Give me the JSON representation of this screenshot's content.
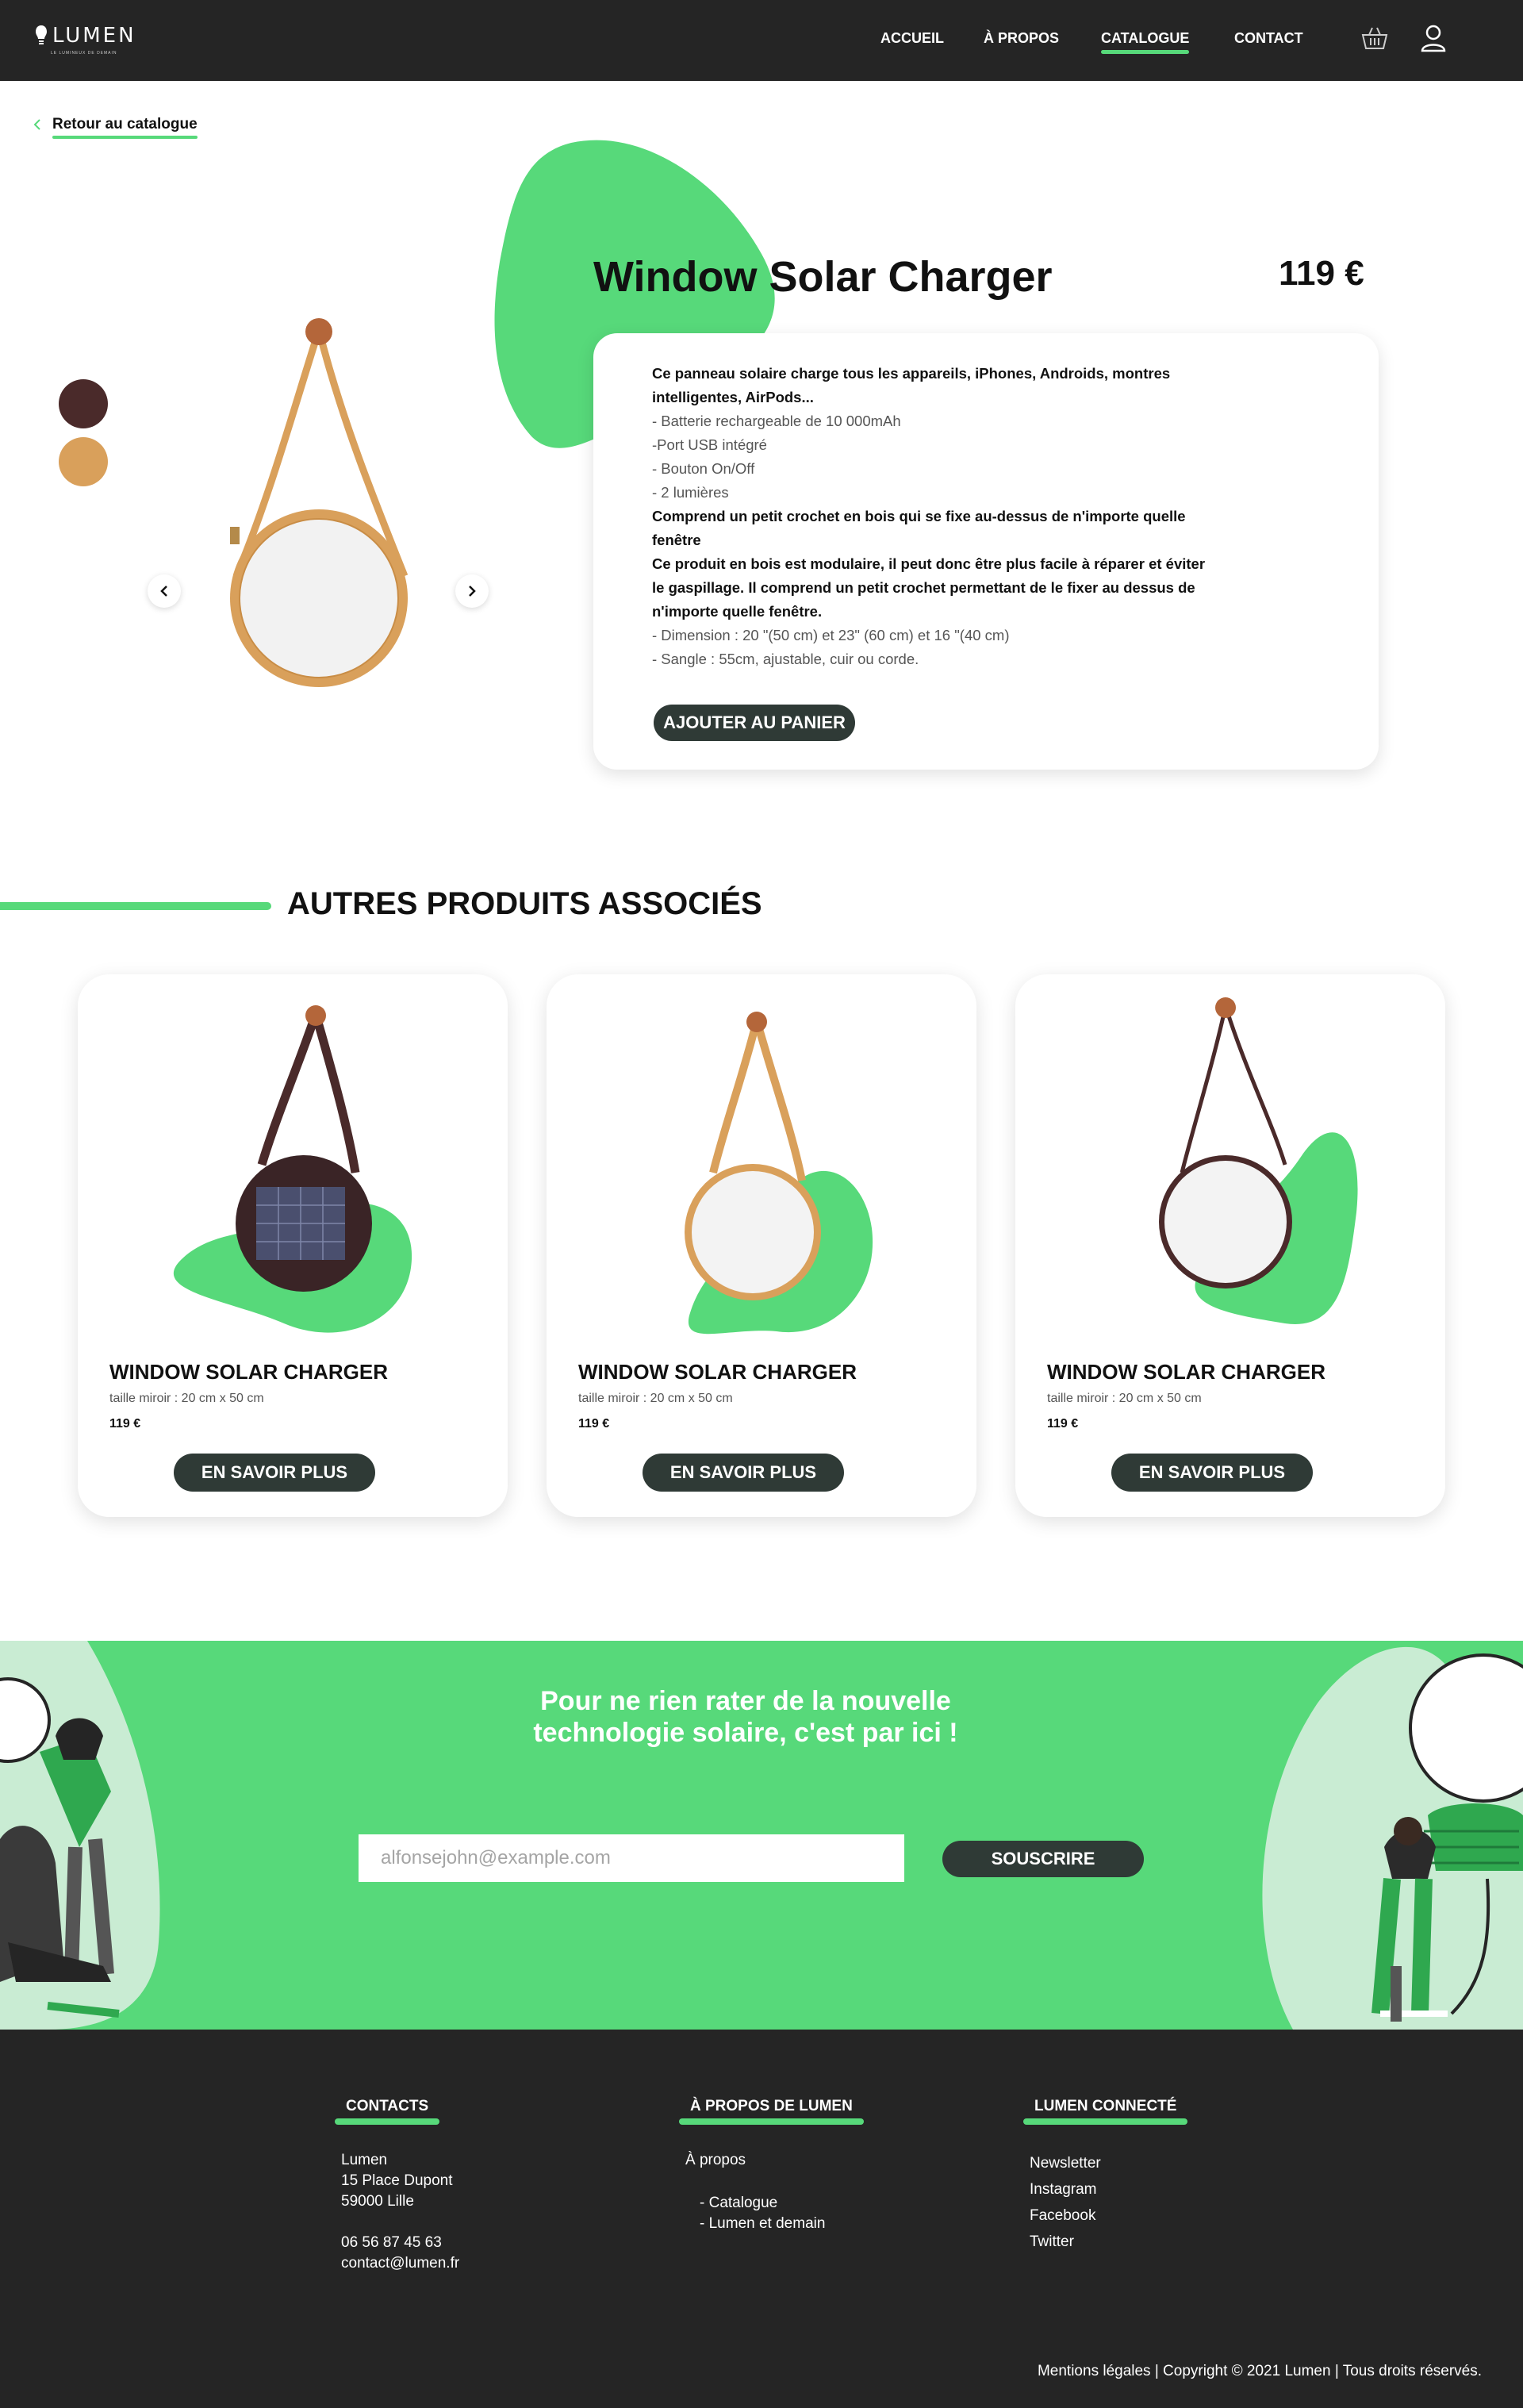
{
  "header": {
    "logo_text": "LUMEN",
    "logo_tagline": "LE LUMINEUX DE DEMAIN",
    "nav": [
      {
        "label": "ACCUEIL",
        "active": false
      },
      {
        "label": "À PROPOS",
        "active": false
      },
      {
        "label": "CATALOGUE",
        "active": true
      },
      {
        "label": "CONTACT",
        "active": false
      }
    ],
    "icons": [
      "basket-icon",
      "user-icon"
    ]
  },
  "back_link": {
    "label": "Retour au catalogue"
  },
  "product": {
    "title": "Window Solar Charger",
    "price": "119 €",
    "swatches": [
      "#4a2a2a",
      "#d9a05b"
    ],
    "description": [
      {
        "text": "Ce panneau solaire charge tous les appareils, iPhones, Androids, montres",
        "style": "b"
      },
      {
        "text": "intelligentes, AirPods...",
        "style": "b"
      },
      {
        "text": "- Batterie rechargeable de 10 000mAh",
        "style": "l"
      },
      {
        "text": "-Port USB intégré",
        "style": "l"
      },
      {
        "text": "- Bouton On/Off",
        "style": "l"
      },
      {
        "text": "- 2 lumières",
        "style": "l"
      },
      {
        "text": "Comprend un petit crochet en bois qui se fixe au-dessus de n'importe quelle",
        "style": "b"
      },
      {
        "text": "fenêtre",
        "style": "b"
      },
      {
        "text": "Ce produit en bois est modulaire, il peut donc être plus facile à réparer et éviter",
        "style": "b"
      },
      {
        "text": "le gaspillage. Il comprend un petit crochet permettant de le fixer au dessus de",
        "style": "b"
      },
      {
        "text": "n'importe quelle fenêtre.",
        "style": "b"
      },
      {
        "text": "- Dimension : 20 \"(50 cm) et 23\" (60 cm) et 16 \"(40 cm)",
        "style": "l"
      },
      {
        "text": "- Sangle : 55cm, ajustable, cuir ou corde.",
        "style": "l"
      }
    ],
    "add_to_cart": "AJOUTER AU PANIER"
  },
  "related": {
    "title": "AUTRES PRODUITS ASSOCIÉS",
    "items": [
      {
        "name": "WINDOW SOLAR CHARGER",
        "size": "taille miroir : 20 cm x 50 cm",
        "price": "119 €",
        "button": "EN SAVOIR PLUS",
        "variant": "dark-solar"
      },
      {
        "name": "WINDOW SOLAR CHARGER",
        "size": "taille miroir : 20 cm x 50 cm",
        "price": "119 €",
        "button": "EN SAVOIR PLUS",
        "variant": "tan-mirror"
      },
      {
        "name": "WINDOW SOLAR CHARGER",
        "size": "taille miroir : 20 cm x 50 cm",
        "price": "119 €",
        "button": "EN SAVOIR PLUS",
        "variant": "dark-mirror"
      }
    ]
  },
  "newsletter": {
    "title_line1": "Pour ne rien rater de la nouvelle",
    "title_line2": "technologie solaire, c'est par ici !",
    "placeholder": "alfonsejohn@example.com",
    "button": "SOUSCRIRE"
  },
  "footer": {
    "contacts": {
      "heading": "CONTACTS",
      "lines": [
        "Lumen",
        "15 Place Dupont",
        "59000 Lille",
        "",
        "06 56 87 45 63",
        "contact@lumen.fr"
      ]
    },
    "about": {
      "heading": "À PROPOS DE LUMEN",
      "link": "À propos",
      "sublinks": [
        "- Catalogue",
        "- Lumen et demain"
      ]
    },
    "connected": {
      "heading": "LUMEN CONNECTÉ",
      "links": [
        "Newsletter",
        "Instagram",
        "Facebook",
        "Twitter"
      ]
    },
    "legal": "Mentions légales | Copyright © 2021 Lumen | Tous droits réservés."
  },
  "colors": {
    "accent": "#57d97a",
    "dark": "#252525",
    "button": "#2f3a36"
  }
}
